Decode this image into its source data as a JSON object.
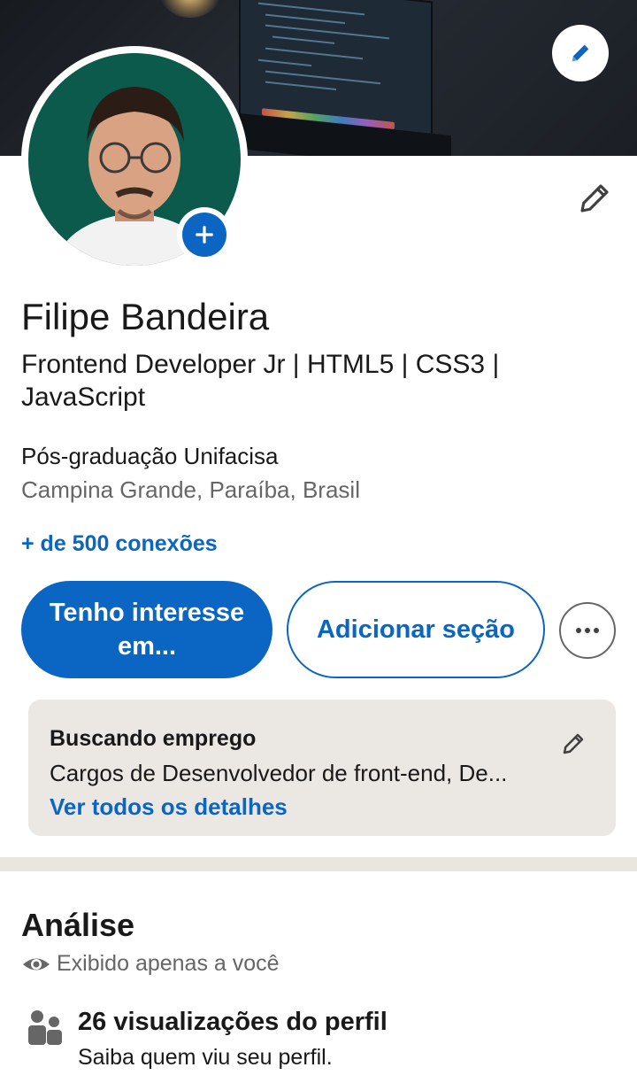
{
  "profile": {
    "name": "Filipe Bandeira",
    "headline": "Frontend Developer Jr | HTML5  | CSS3 | JavaScript",
    "education": "Pós-graduação Unifacisa",
    "location": "Campina Grande, Paraíba, Brasil",
    "connections": "+ de 500 conexões"
  },
  "actions": {
    "primary_label": "Tenho interesse em...",
    "secondary_label": "Adicionar seção",
    "more_label": "..."
  },
  "open_to_work": {
    "title": "Buscando emprego",
    "description": "Cargos de Desenvolvedor de front-end, De...",
    "link": "Ver todos os detalhes"
  },
  "analytics": {
    "title": "Análise",
    "visibility_note": "Exibido apenas a você",
    "stats": [
      {
        "title": "26 visualizações do perfil",
        "subtitle": "Saiba quem viu seu perfil."
      }
    ]
  },
  "icons": {
    "cover_edit": "pencil-icon",
    "add_photo": "plus-icon",
    "intro_edit": "pencil-icon",
    "more": "ellipsis-icon",
    "job_edit": "pencil-icon",
    "visibility": "eye-icon",
    "views": "people-icon"
  },
  "colors": {
    "accent": "#0a66c2",
    "card_bg": "#ebe8e3",
    "secondary_text": "#666666"
  }
}
